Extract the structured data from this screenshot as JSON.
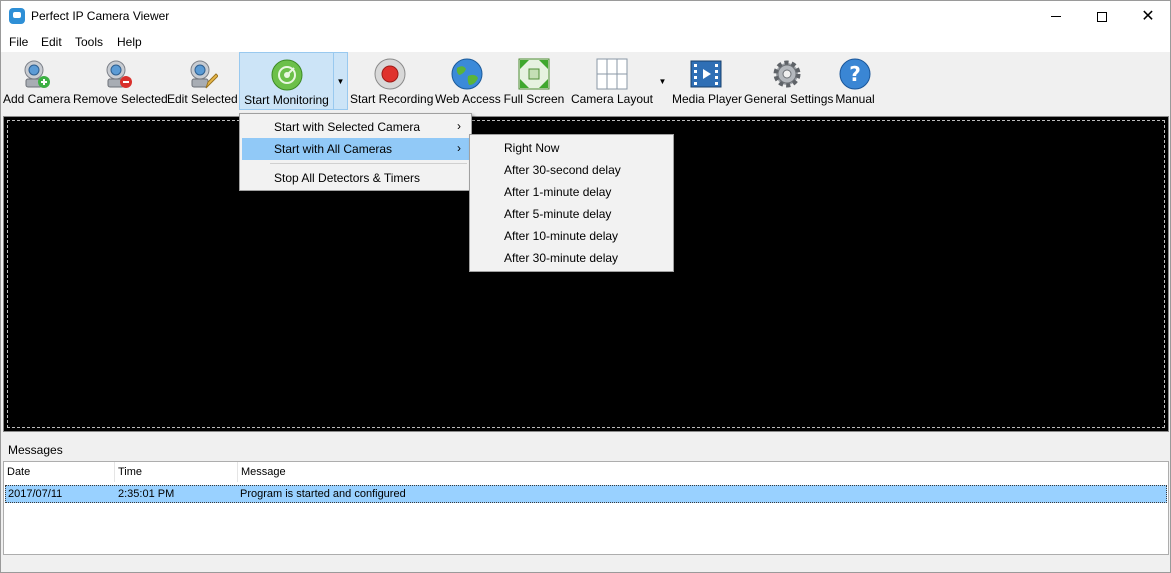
{
  "window": {
    "title": "Perfect IP Camera Viewer"
  },
  "menubar": {
    "items": [
      "File",
      "Edit",
      "Tools",
      "Help"
    ]
  },
  "toolbar": {
    "add_camera": "Add Camera",
    "remove_selected": "Remove Selected",
    "edit_selected": "Edit Selected",
    "start_monitoring": "Start Monitoring",
    "start_recording": "Start Recording",
    "web_access": "Web Access",
    "full_screen": "Full Screen",
    "camera_layout": "Camera Layout",
    "media_player": "Media Player",
    "general_settings": "General Settings",
    "manual": "Manual"
  },
  "monitoring_menu": {
    "items": [
      "Start with Selected Camera",
      "Start with All Cameras",
      "Stop All Detectors & Timers"
    ]
  },
  "delay_submenu": {
    "items": [
      "Right Now",
      "After 30-second delay",
      "After 1-minute delay",
      "After 5-minute delay",
      "After 10-minute delay",
      "After 30-minute delay"
    ]
  },
  "messages": {
    "title": "Messages",
    "columns": [
      "Date",
      "Time",
      "Message"
    ],
    "rows": [
      {
        "date": "2017/07/11",
        "time": "2:35:01 PM",
        "message": "Program is started and configured"
      }
    ]
  },
  "colors": {
    "selection": "#99d1ff",
    "menu_highlight": "#91c9f7",
    "toolbar_active": "#cce4f7",
    "video_bg": "#000000"
  }
}
